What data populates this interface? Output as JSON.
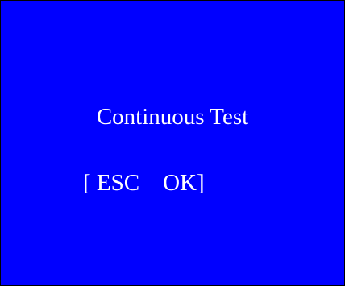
{
  "screen": {
    "background": "#0000ff",
    "text_color": "#ffffff",
    "title": "Continuous Test",
    "prompt": {
      "open_bracket": "[ ",
      "esc_label": "ESC",
      "gap": "    ",
      "ok_label": "OK",
      "close_bracket": "]"
    }
  }
}
